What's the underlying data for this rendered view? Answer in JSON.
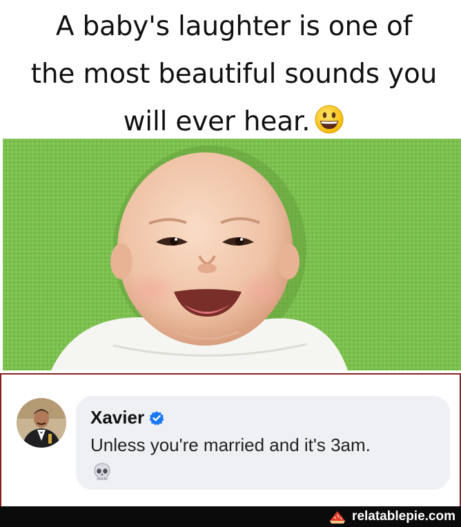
{
  "caption": {
    "line1": "A baby's laughter is one of",
    "line2": "the most beautiful sounds you",
    "line3": "will ever hear.",
    "emoji": "grinning-face-emoji"
  },
  "photo": {
    "subject": "smiling-baby-image",
    "background_color": "#7bbf4f"
  },
  "comment": {
    "author": "Xavier",
    "verified": true,
    "text": "Unless you're married and it's 3am.",
    "reaction_emoji": "skull-emoji",
    "frame_color": "#8a1f1f",
    "bubble_color": "#eef0f3",
    "verified_color": "#1877f2"
  },
  "footer": {
    "brand": "relatablepie.com"
  }
}
